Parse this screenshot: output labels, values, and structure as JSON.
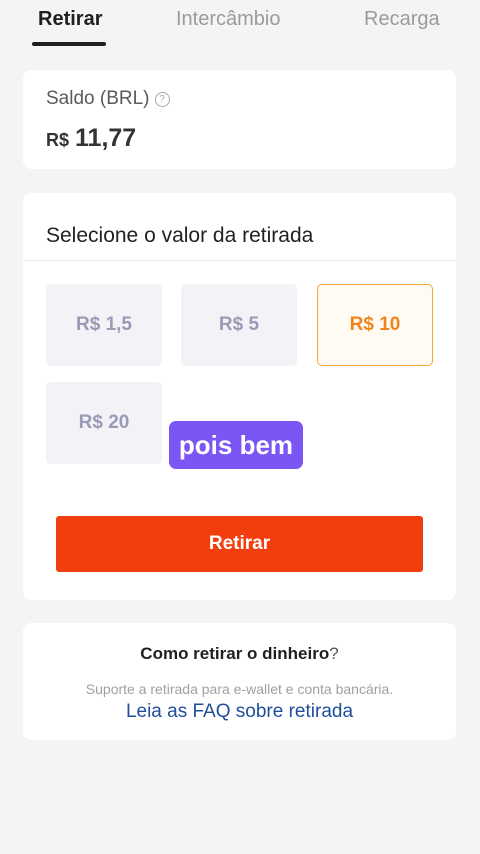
{
  "tabs": [
    {
      "label": "Retirar"
    },
    {
      "label": "Intercâmbio"
    },
    {
      "label": "Recarga"
    }
  ],
  "balance": {
    "label": "Saldo (BRL)",
    "currency": "R$",
    "amount": "11,77"
  },
  "select": {
    "title": "Selecione o valor da retirada",
    "options": [
      "R$ 1,5",
      "R$ 5",
      "R$ 10",
      "R$ 20"
    ],
    "selected": "R$ 10",
    "button_label": "Retirar"
  },
  "overlay": {
    "text": "pois bem"
  },
  "howto": {
    "title": "Como retirar o dinheiro",
    "question_mark": "?",
    "description": "Suporte a retirada para e-wallet e conta bancária.",
    "link": "Leia as FAQ sobre retirada"
  },
  "colors": {
    "accent": "#f23d0c",
    "selected_option": "#f0861a",
    "overlay": "#7b56f4",
    "link": "#1f4f9c"
  },
  "icons": {
    "help": "question-circle-icon"
  }
}
